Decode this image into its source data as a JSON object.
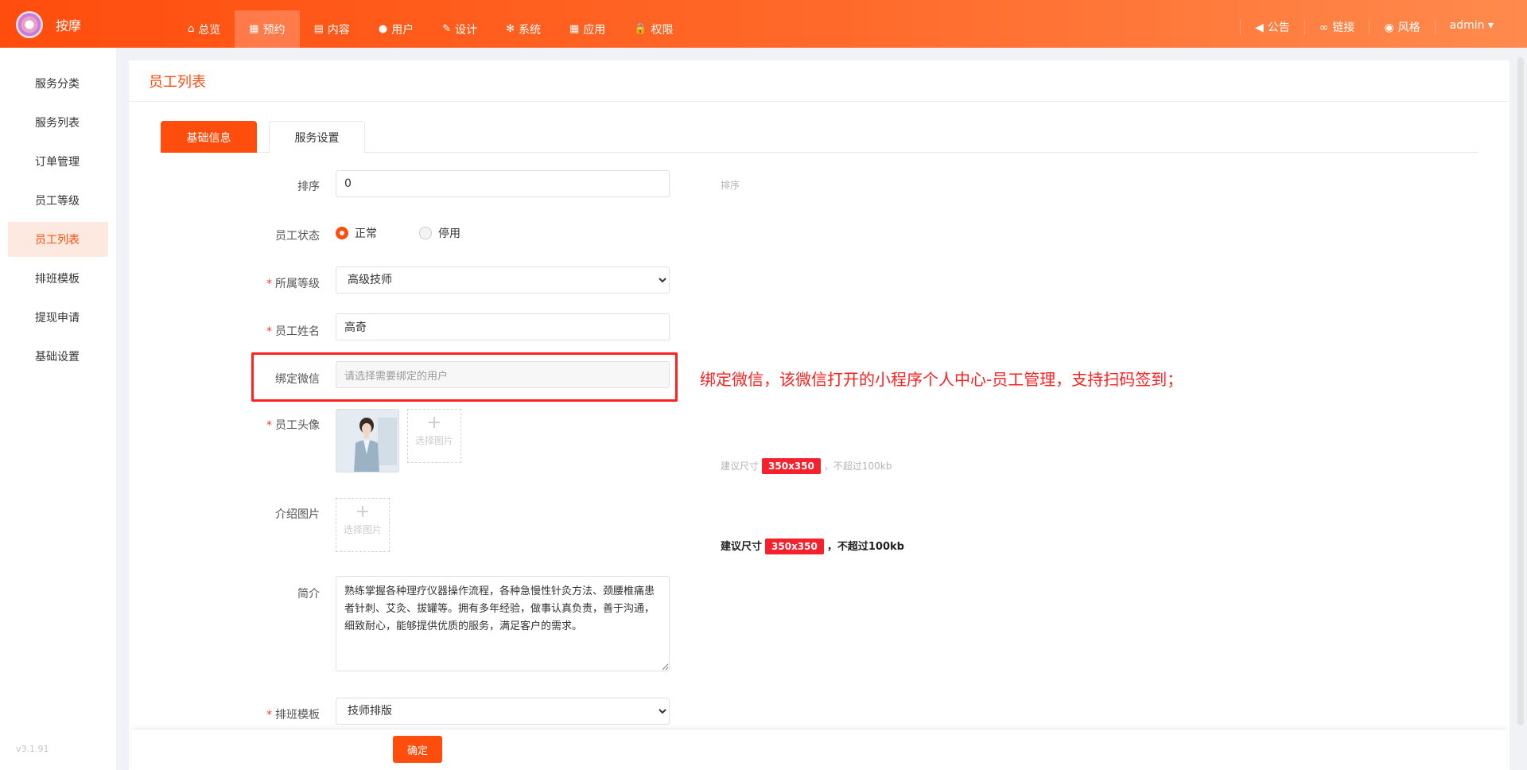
{
  "brand": {
    "name": "按摩"
  },
  "nav": {
    "items": [
      {
        "label": "总览",
        "icon": "home-icon",
        "glyph": "⌂"
      },
      {
        "label": "预约",
        "icon": "calendar-icon",
        "glyph": "▦",
        "active": true
      },
      {
        "label": "内容",
        "icon": "document-icon",
        "glyph": "▤"
      },
      {
        "label": "用户",
        "icon": "user-icon",
        "glyph": "●"
      },
      {
        "label": "设计",
        "icon": "brush-icon",
        "glyph": "✎"
      },
      {
        "label": "系统",
        "icon": "gear-icon",
        "glyph": "✻"
      },
      {
        "label": "应用",
        "icon": "apps-icon",
        "glyph": "▦"
      },
      {
        "label": "权限",
        "icon": "lock-icon",
        "glyph": "🔒"
      }
    ],
    "right": [
      {
        "label": "公告",
        "icon": "megaphone-icon",
        "glyph": "◀"
      },
      {
        "label": "链接",
        "icon": "link-icon",
        "glyph": "∞"
      },
      {
        "label": "风格",
        "icon": "palette-icon",
        "glyph": "◉"
      },
      {
        "label": "admin ▾",
        "icon": "",
        "glyph": ""
      }
    ]
  },
  "sidebar": {
    "items": [
      {
        "label": "服务分类"
      },
      {
        "label": "服务列表"
      },
      {
        "label": "订单管理"
      },
      {
        "label": "员工等级"
      },
      {
        "label": "员工列表",
        "active": true
      },
      {
        "label": "排班模板"
      },
      {
        "label": "提现申请"
      },
      {
        "label": "基础设置"
      }
    ],
    "version": "v3.1.91"
  },
  "page": {
    "title": "员工列表"
  },
  "tabs": [
    {
      "label": "基础信息",
      "active": true
    },
    {
      "label": "服务设置",
      "active": false
    }
  ],
  "form": {
    "sort": {
      "label": "排序",
      "value": "0",
      "hint": "排序"
    },
    "status": {
      "label": "员工状态",
      "options": [
        "正常",
        "停用"
      ],
      "selected": "正常"
    },
    "level": {
      "label": "所属等级",
      "value": "高级技师",
      "required": true
    },
    "name": {
      "label": "员工姓名",
      "value": "高奇",
      "required": true
    },
    "wechat": {
      "label": "绑定微信",
      "placeholder": "请选择需要绑定的用户"
    },
    "avatar": {
      "label": "员工头像",
      "required": true,
      "upload_label": "选择图片",
      "hint_prefix": "建议尺寸",
      "hint_size": "350x350",
      "hint_suffix": "，不超过100kb"
    },
    "intro_images": {
      "label": "介绍图片",
      "upload_label": "选择图片",
      "hint_prefix": "建议尺寸",
      "hint_size": "350x350",
      "hint_suffix": "，不超过100kb"
    },
    "bio": {
      "label": "简介",
      "value": "熟练掌握各种理疗仪器操作流程，各种急慢性针灸方法、颈腰椎痛患者针刺、艾灸、拔罐等。拥有多年经验，做事认真负责，善于沟通，细致耐心，能够提供优质的服务，满足客户的需求。"
    },
    "schedule": {
      "label": "排班模板",
      "value": "技师排版",
      "required": true
    }
  },
  "annotation": "绑定微信，该微信打开的小程序个人中心-员工管理，支持扫码签到；",
  "actions": {
    "confirm": "确定"
  },
  "colors": {
    "accent": "#ff4d0d",
    "annotation": "#ff2020",
    "badge": "#f5222d"
  }
}
